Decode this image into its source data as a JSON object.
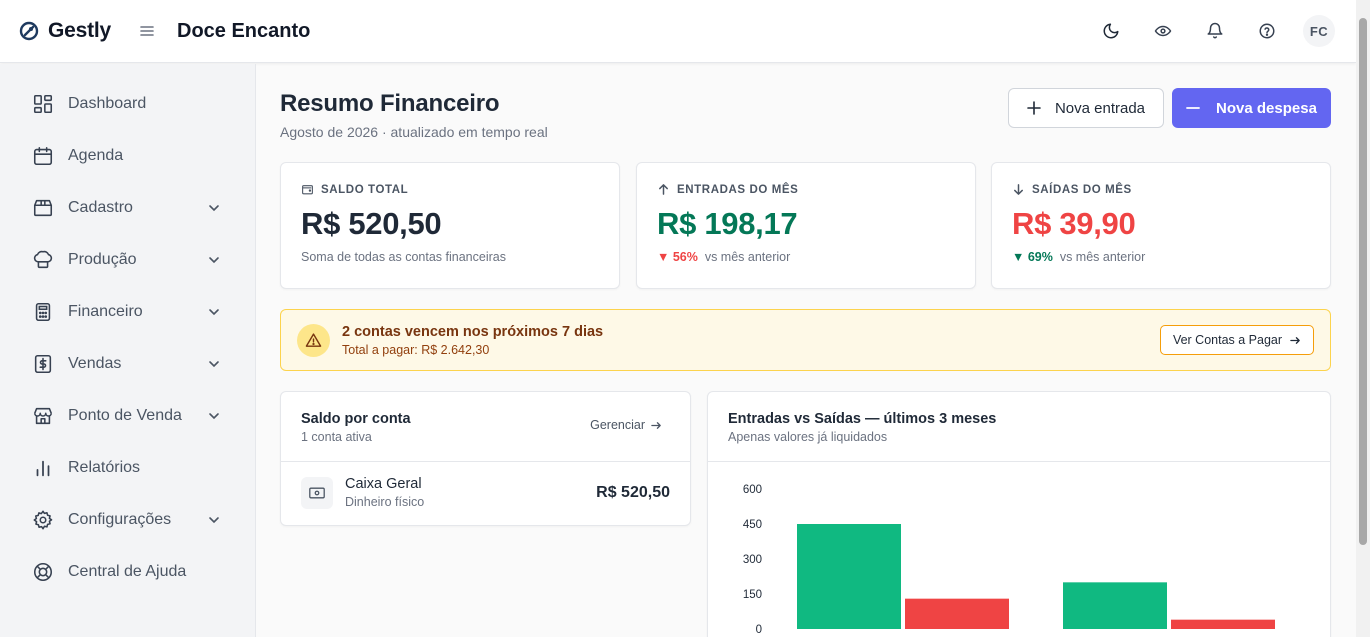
{
  "app": {
    "brand": "Gestly",
    "org_name": "Doce Encanto"
  },
  "topbar": {
    "avatar_initials": "FC",
    "icons": [
      "moon-icon",
      "eye-icon",
      "bell-icon",
      "help-icon"
    ]
  },
  "sidebar": {
    "items": [
      {
        "label": "Dashboard",
        "icon": "dashboard-icon",
        "expandable": false
      },
      {
        "label": "Agenda",
        "icon": "calendar-icon",
        "expandable": false
      },
      {
        "label": "Cadastro",
        "icon": "box-icon",
        "expandable": true
      },
      {
        "label": "Produção",
        "icon": "chef-hat-icon",
        "expandable": true
      },
      {
        "label": "Financeiro",
        "icon": "calculator-icon",
        "expandable": true
      },
      {
        "label": "Vendas",
        "icon": "dollar-doc-icon",
        "expandable": true
      },
      {
        "label": "Ponto de Venda",
        "icon": "store-icon",
        "expandable": true
      },
      {
        "label": "Relatórios",
        "icon": "bar-chart-icon",
        "expandable": false
      },
      {
        "label": "Configurações",
        "icon": "gear-icon",
        "expandable": true
      },
      {
        "label": "Central de Ajuda",
        "icon": "lifebuoy-icon",
        "expandable": false
      }
    ]
  },
  "header": {
    "title": "Resumo Financeiro",
    "subtitle": "Agosto de 2026 · atualizado em tempo real",
    "new_entry_label": "Nova entrada",
    "new_expense_label": "Nova despesa"
  },
  "kpis": {
    "balance": {
      "label": "SALDO TOTAL",
      "value": "R$ 520,50",
      "foot": "Soma de todas as contas financeiras"
    },
    "income": {
      "label": "ENTRADAS DO MÊS",
      "value": "R$ 198,17",
      "delta": "▼ 56%",
      "foot": "vs mês anterior"
    },
    "expenses": {
      "label": "SAÍDAS DO MÊS",
      "value": "R$ 39,90",
      "delta": "▼ 69%",
      "foot": "vs mês anterior"
    }
  },
  "alert": {
    "title": "2 contas vencem nos próximos 7 dias",
    "subtitle": "Total a pagar: R$ 2.642,30",
    "button_label": "Ver Contas a Pagar"
  },
  "accounts_card": {
    "title": "Saldo por conta",
    "subtitle": "1 conta ativa",
    "manage_label": "Gerenciar",
    "accounts": [
      {
        "name": "Caixa Geral",
        "type": "Dinheiro físico",
        "balance": "R$ 520,50"
      }
    ]
  },
  "chart_card": {
    "title": "Entradas vs Saídas — últimos 3 meses",
    "subtitle": "Apenas valores já liquidados"
  },
  "colors": {
    "income": "#10b981",
    "expense": "#ef4444",
    "primary": "#6366f1",
    "income_text": "#047857",
    "expense_text": "#ef4444"
  },
  "chart_data": {
    "type": "bar",
    "categories": [
      "",
      "",
      ""
    ],
    "series": [
      {
        "values": [
          450,
          200,
          null
        ]
      },
      {
        "values": [
          130,
          40,
          null
        ]
      }
    ],
    "yticks": [
      600,
      450,
      300,
      150,
      0
    ],
    "ylim": [
      0,
      600
    ],
    "title": "Entradas vs Saídas — últimos 3 meses",
    "grid": false
  }
}
